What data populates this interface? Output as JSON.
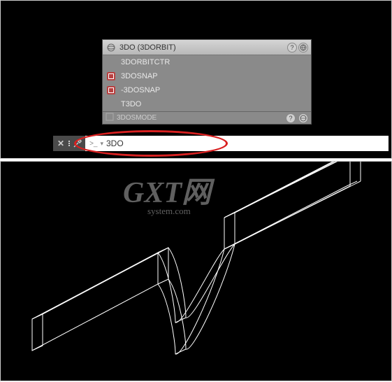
{
  "autocomplete": {
    "header_text": "3DO (3DORBIT)",
    "items": [
      {
        "label": "3DORBITCTR",
        "icon": "none"
      },
      {
        "label": "3DOSNAP",
        "icon": "snap"
      },
      {
        "label": "-3DOSNAP",
        "icon": "snap"
      },
      {
        "label": "T3DO",
        "icon": "none"
      }
    ],
    "footer_label": "3DOSMODE"
  },
  "command_input": {
    "value": "3DO",
    "prompt_symbol": ">_"
  },
  "watermark": {
    "main": "GXT网",
    "sub": "system.com"
  }
}
